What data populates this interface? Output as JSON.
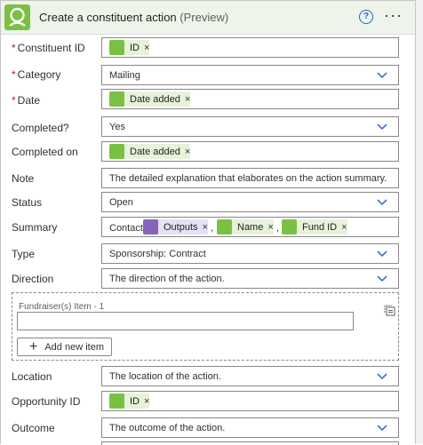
{
  "header": {
    "title": "Create a constituent action",
    "preview": "(Preview)",
    "help_glyph": "?",
    "more_glyph": "···",
    "accent": "#7ac143"
  },
  "fields": {
    "constituent_id": {
      "label": "Constituent ID",
      "required_mark": "*",
      "token": "ID",
      "remove": "×"
    },
    "category": {
      "label": "Category",
      "required_mark": "*",
      "value": "Mailing"
    },
    "date": {
      "label": "Date",
      "required_mark": "*",
      "token": "Date added",
      "remove": "×"
    },
    "completed": {
      "label": "Completed?",
      "value": "Yes"
    },
    "completed_on": {
      "label": "Completed on",
      "token": "Date added",
      "remove": "×"
    },
    "note": {
      "label": "Note",
      "placeholder": "The detailed explanation that elaborates on the action summary."
    },
    "status": {
      "label": "Status",
      "value": "Open"
    },
    "summary": {
      "label": "Summary",
      "prefix": "Contact:",
      "token_outputs": "Outputs",
      "token_name": "Name",
      "token_fund": "Fund ID",
      "remove": "×",
      "sep": ","
    },
    "type": {
      "label": "Type",
      "value": "Sponsorship: Contract"
    },
    "direction": {
      "label": "Direction",
      "placeholder": "The direction of the action."
    },
    "fundraiser": {
      "label": "Fundraiser(s) Item - 1",
      "add_label": "Add new item",
      "plus": "+"
    },
    "location": {
      "label": "Location",
      "placeholder": "The location of the action."
    },
    "opportunity_id": {
      "label": "Opportunity ID",
      "token": "ID",
      "remove": "×"
    },
    "outcome": {
      "label": "Outcome",
      "placeholder": "The outcome of the action."
    }
  }
}
